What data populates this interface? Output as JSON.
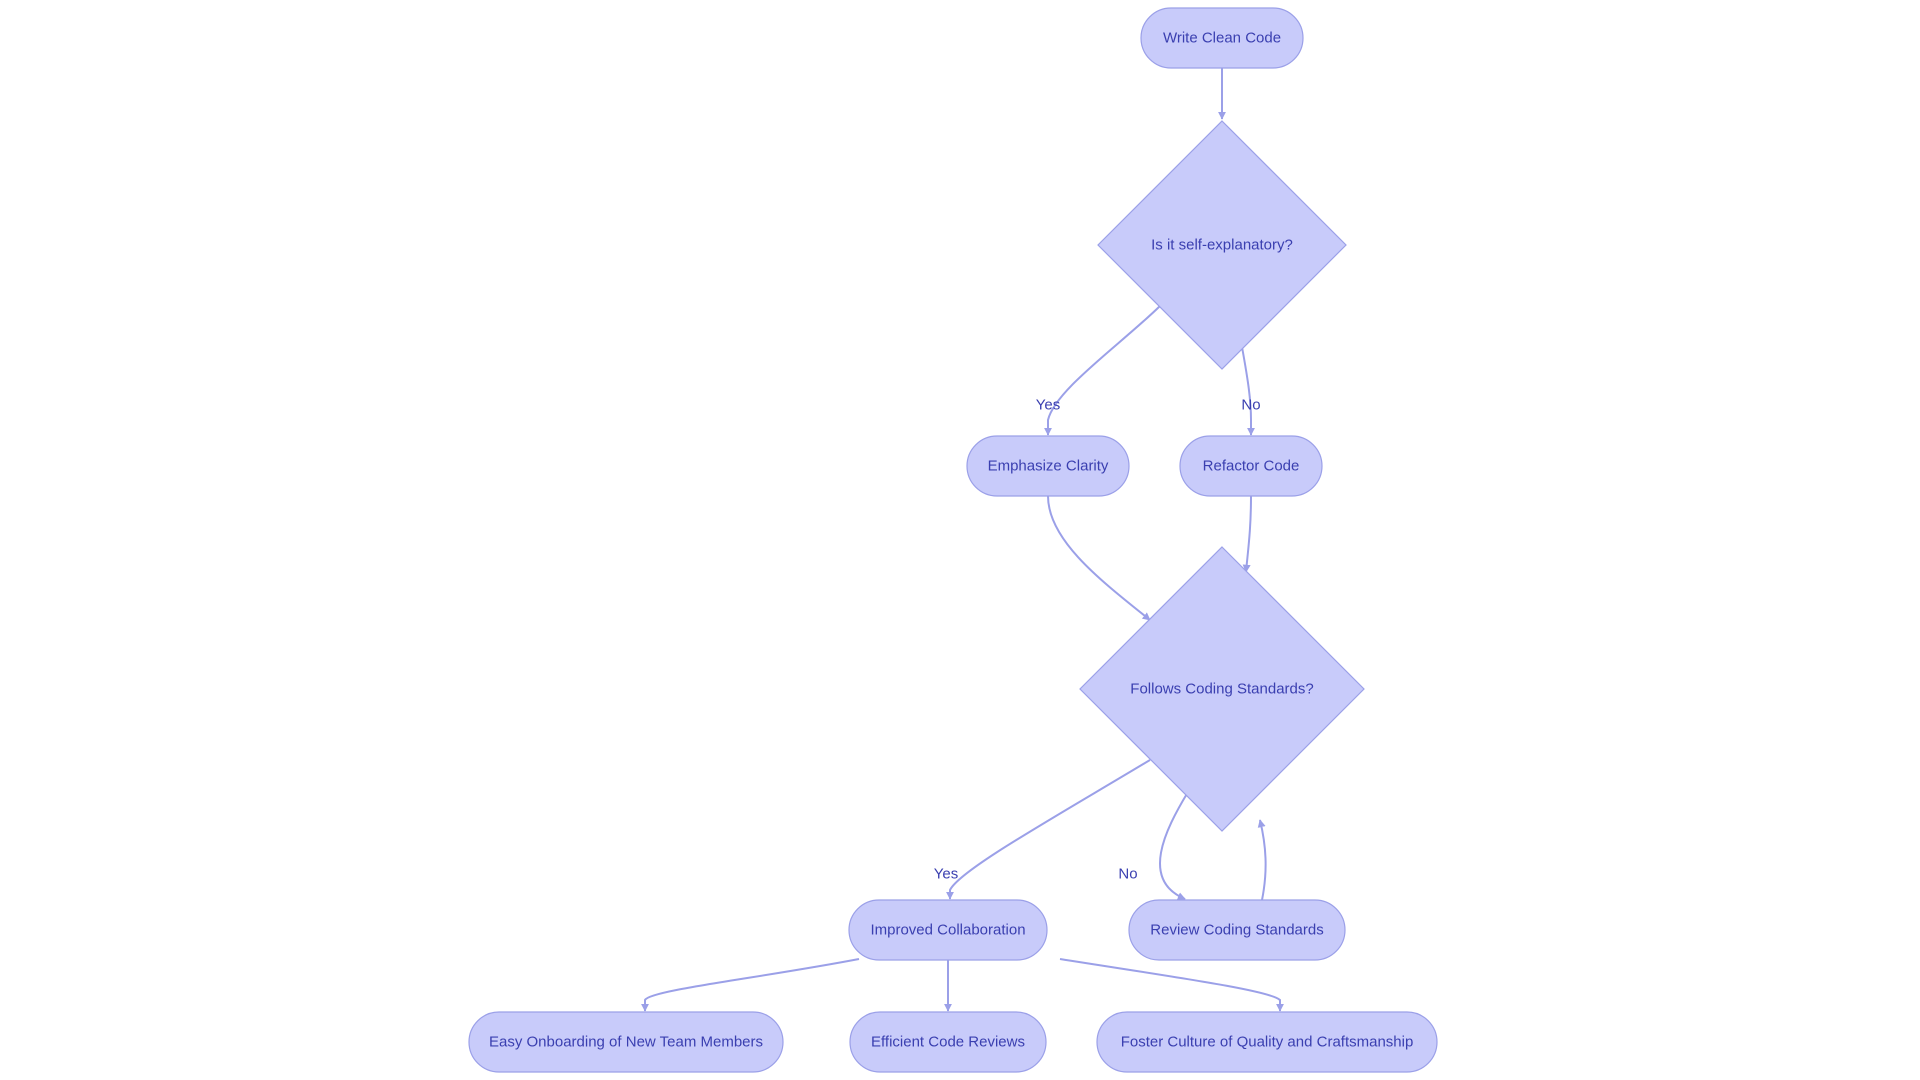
{
  "diagram": {
    "type": "flowchart",
    "colors": {
      "node_fill": "#c8cbfa",
      "node_stroke": "#9ba0e8",
      "text": "#3a3fb0",
      "edge": "#9ba0e8",
      "background": "#ffffff"
    },
    "nodes": [
      {
        "id": "write",
        "label": "Write Clean Code",
        "shape": "stadium"
      },
      {
        "id": "selfexp",
        "label": "Is it self-explanatory?",
        "shape": "diamond"
      },
      {
        "id": "emph",
        "label": "Emphasize Clarity",
        "shape": "stadium"
      },
      {
        "id": "refactor",
        "label": "Refactor Code",
        "shape": "stadium"
      },
      {
        "id": "standards",
        "label": "Follows Coding Standards?",
        "shape": "diamond"
      },
      {
        "id": "collab",
        "label": "Improved Collaboration",
        "shape": "stadium"
      },
      {
        "id": "review",
        "label": "Review Coding Standards",
        "shape": "stadium"
      },
      {
        "id": "onboard",
        "label": "Easy Onboarding of New Team Members",
        "shape": "stadium"
      },
      {
        "id": "reviews",
        "label": "Efficient Code Reviews",
        "shape": "stadium"
      },
      {
        "id": "culture",
        "label": "Foster Culture of Quality and Craftsmanship",
        "shape": "stadium"
      }
    ],
    "edges": [
      {
        "from": "write",
        "to": "selfexp",
        "label": ""
      },
      {
        "from": "selfexp",
        "to": "emph",
        "label": "Yes"
      },
      {
        "from": "selfexp",
        "to": "refactor",
        "label": "No"
      },
      {
        "from": "emph",
        "to": "standards",
        "label": ""
      },
      {
        "from": "refactor",
        "to": "standards",
        "label": ""
      },
      {
        "from": "standards",
        "to": "collab",
        "label": "Yes"
      },
      {
        "from": "standards",
        "to": "review",
        "label": "No"
      },
      {
        "from": "review",
        "to": "standards",
        "label": ""
      },
      {
        "from": "collab",
        "to": "onboard",
        "label": ""
      },
      {
        "from": "collab",
        "to": "reviews",
        "label": ""
      },
      {
        "from": "collab",
        "to": "culture",
        "label": ""
      }
    ]
  }
}
